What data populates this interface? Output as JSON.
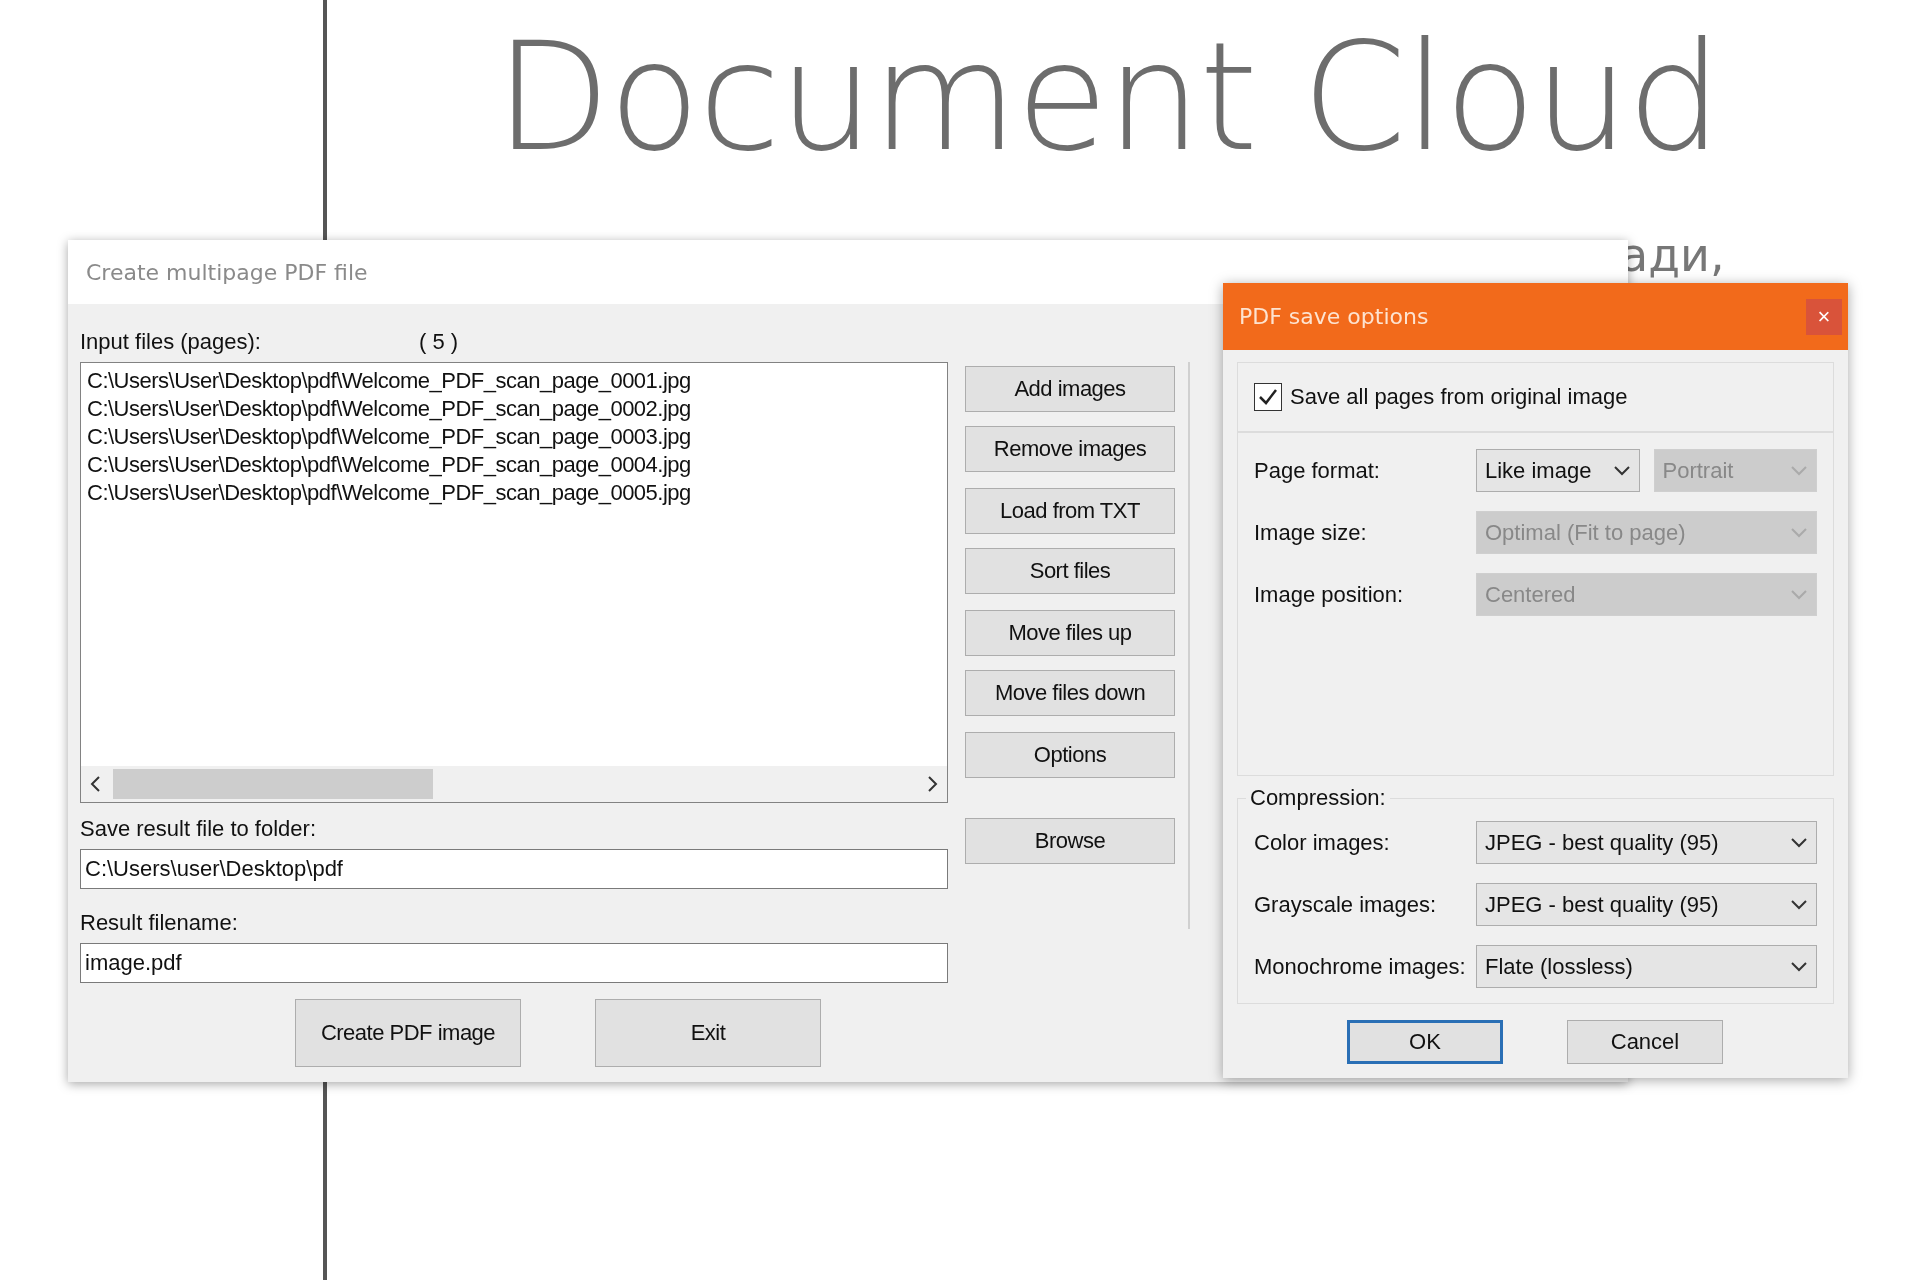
{
  "background": {
    "heading": "Document Cloud",
    "side_text": "ади,"
  },
  "main_window": {
    "title": "Create multipage PDF file",
    "input_label": "Input files (pages):",
    "count": "( 5 )",
    "files": [
      "C:\\Users\\User\\Desktop\\pdf\\Welcome_PDF_scan_page_0001.jpg",
      "C:\\Users\\User\\Desktop\\pdf\\Welcome_PDF_scan_page_0002.jpg",
      "C:\\Users\\User\\Desktop\\pdf\\Welcome_PDF_scan_page_0003.jpg",
      "C:\\Users\\User\\Desktop\\pdf\\Welcome_PDF_scan_page_0004.jpg",
      "C:\\Users\\User\\Desktop\\pdf\\Welcome_PDF_scan_page_0005.jpg"
    ],
    "side_buttons": [
      [
        "Add images",
        "Remove images"
      ],
      [
        "Load from TXT",
        "Sort files"
      ],
      [
        "Move files up",
        "Move files down"
      ],
      [
        "Options"
      ]
    ],
    "folder_label": "Save result file to folder:",
    "folder_value": "C:\\Users\\user\\Desktop\\pdf",
    "browse": "Browse",
    "filename_label": "Result filename:",
    "filename_value": "image.pdf",
    "buttons": [
      "Create PDF image",
      "Exit"
    ]
  },
  "options_dialog": {
    "title": "PDF save options",
    "close": "×",
    "save_all": {
      "label": "Save all pages from original image",
      "checked": true
    },
    "layout_rows": [
      {
        "label": "Page format:",
        "combos": [
          {
            "value": "Like image",
            "disabled": false
          },
          {
            "value": "Portrait",
            "disabled": true
          }
        ]
      },
      {
        "label": "Image size:",
        "combos": [
          {
            "value": "Optimal (Fit to page)",
            "disabled": true
          }
        ]
      },
      {
        "label": "Image position:",
        "combos": [
          {
            "value": "Centered",
            "disabled": true
          }
        ]
      }
    ],
    "compression_label": "Compression:",
    "compression_rows": [
      {
        "label": "Color images:",
        "combos": [
          {
            "value": "JPEG - best quality (95)",
            "disabled": false
          }
        ]
      },
      {
        "label": "Grayscale images:",
        "combos": [
          {
            "value": "JPEG - best quality (95)",
            "disabled": false
          }
        ]
      },
      {
        "label": "Monochrome images:",
        "combos": [
          {
            "value": "Flate (lossless)",
            "disabled": false
          }
        ]
      }
    ],
    "buttons": [
      {
        "label": "OK",
        "default": true
      },
      {
        "label": "Cancel",
        "default": false
      }
    ]
  }
}
